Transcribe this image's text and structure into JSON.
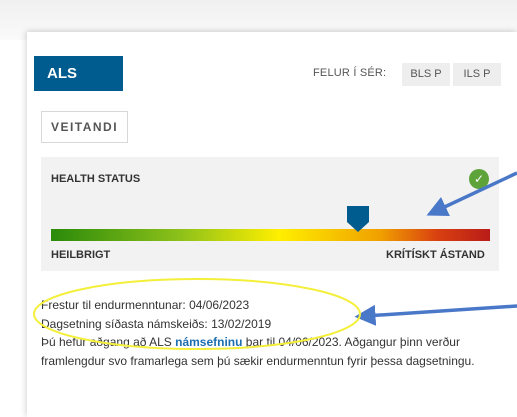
{
  "card": {
    "title": "ALS",
    "hidden_label": "FELUR Í SÉR:",
    "chips": [
      "BLS P",
      "ILS P"
    ],
    "role": "VEITANDI"
  },
  "health": {
    "label": "HEALTH STATUS",
    "left_label": "HEILBRIGT",
    "right_label": "KRÍTÍSKT ÁSTAND",
    "status_level": 0.7,
    "status_icon": "check-circle-icon",
    "marker_color": "#005b8e"
  },
  "info": {
    "deadline": "Frestur til endurmenntunar: 04/06/2023",
    "last_course": "Dagsetning síðasta námskeiðs: 13/02/2019",
    "access_pre": "Þú hefur aðgang að ALS ",
    "access_link": "námsefninu",
    "access_post": " þar til 04/06/2023. Aðgangur þinn verður framlengdur svo framarlega sem þú sækir endurmenntun fyrir þessa dagsetningu."
  },
  "colors": {
    "primary": "#005b8e",
    "annotation_arrow": "#4a78c8",
    "annotation_ellipse": "#f4ef3a"
  }
}
